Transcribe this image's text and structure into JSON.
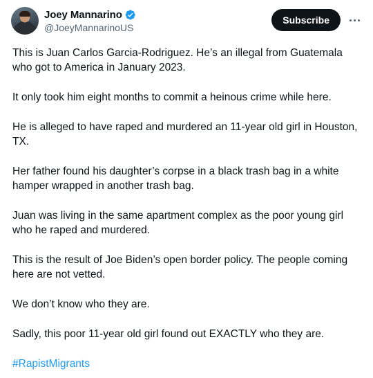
{
  "author": {
    "display_name": "Joey Mannarino",
    "handle": "@JoeyMannarinoUS",
    "verified": true,
    "verified_color": "#1d9bf0"
  },
  "actions": {
    "subscribe_label": "Subscribe",
    "more_icon": "more-horizontal-icon"
  },
  "tweet": {
    "paragraphs": [
      "This is Juan Carlos Garcia-Rodriguez. He’s an illegal from Guatemala who got to America in January 2023.",
      "It only took him eight months to commit a heinous crime while here.",
      "He is alleged to have raped and murdered an 11-year old girl in Houston, TX.",
      "Her father found his daughter’s corpse in a black trash bag in a white hamper wrapped in another trash bag.",
      "Juan was living in the same apartment complex as the poor young girl who he raped and murdered.",
      "This is the result of Joe Biden’s open border policy. The people coming here are not vetted.",
      "We don’t know who they are.",
      "Sadly, this poor 11-year old girl found out EXACTLY who they are."
    ],
    "hashtag": "#RapistMigrants",
    "hashtag_color": "#1d9bf0"
  }
}
